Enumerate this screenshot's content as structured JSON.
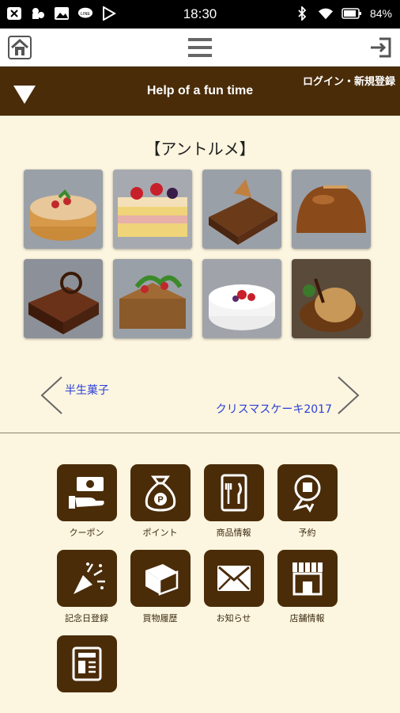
{
  "status_bar": {
    "time": "18:30",
    "battery": "84%",
    "left_icons": [
      "close-box-icon",
      "chat-icon",
      "image-icon",
      "line-icon",
      "play-store-icon"
    ],
    "right_icons": [
      "bluetooth-icon",
      "wifi-icon",
      "battery-icon"
    ]
  },
  "app_bar": {
    "icons": [
      "home-icon",
      "hamburger-menu-icon",
      "exit-icon"
    ]
  },
  "header": {
    "title": "Help of a fun time",
    "login_link": "ログイン・新規登録"
  },
  "section": {
    "title": "【アントルメ】"
  },
  "pager": {
    "prev_label": "半生菓子",
    "next_label": "クリスマスケーキ2017"
  },
  "menu": [
    {
      "label": "クーポン",
      "icon": "coupon-icon"
    },
    {
      "label": "ポイント",
      "icon": "points-bag-icon"
    },
    {
      "label": "商品情報",
      "icon": "product-info-icon"
    },
    {
      "label": "予約",
      "icon": "reservation-icon"
    },
    {
      "label": "記念日登録",
      "icon": "party-popper-icon"
    },
    {
      "label": "買物履歴",
      "icon": "book-icon"
    },
    {
      "label": "お知らせ",
      "icon": "mail-icon"
    },
    {
      "label": "店舗情報",
      "icon": "shop-icon"
    },
    {
      "label": "",
      "icon": "news-icon"
    }
  ],
  "colors": {
    "brand_brown": "#4a2c09",
    "background": "#fcf5df",
    "link_blue": "#2a3fd8"
  }
}
